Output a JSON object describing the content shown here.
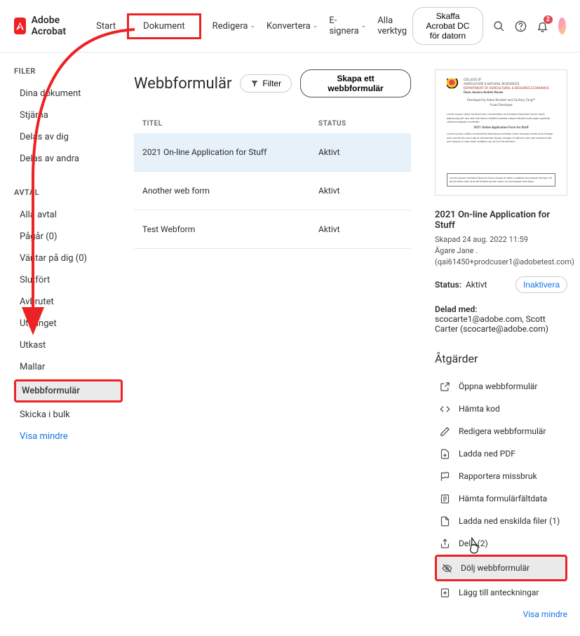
{
  "header": {
    "brand": "Adobe Acrobat",
    "nav": [
      "Start",
      "Dokument",
      "Redigera",
      "Konvertera",
      "E-signera",
      "Alla verktyg"
    ],
    "cta": "Skaffa Acrobat DC för datorn",
    "notification_count": "2"
  },
  "sidebar": {
    "section1_title": "FILER",
    "section1_items": [
      "Dina dokument",
      "Stjärna",
      "Delas av dig",
      "Delas av andra"
    ],
    "section2_title": "AVTAL",
    "section2_items": [
      "Alla avtal",
      "Pågår (0)",
      "Väntar på dig (0)",
      "Slutfört",
      "Avbrutet",
      "Utgånget",
      "Utkast",
      "Mallar",
      "Webbformulär",
      "Skicka i bulk"
    ],
    "show_less": "Visa mindre"
  },
  "content": {
    "title": "Webbformulär",
    "filter_label": "Filter",
    "create_label": "Skapa ett webbformulär",
    "th_title": "TITEL",
    "th_status": "STATUS",
    "rows": [
      {
        "title": "2021 On-line Application for Stuff",
        "status": "Aktivt"
      },
      {
        "title": "Another web form",
        "status": "Aktivt"
      },
      {
        "title": "Test Webform",
        "status": "Aktivt"
      }
    ]
  },
  "details": {
    "title": "2021 On-line Application for Stuff",
    "created": "Skapad 24 aug. 2022 11:59",
    "owner_label": "Ägare Jane .",
    "owner_email": "(qai61450+prodcuser1@adobetest.com)",
    "status_label": "Status:",
    "status_value": "Aktivt",
    "inactivate": "Inaktivera",
    "shared_label": "Delad med:",
    "shared_value": "scocarte1@adobe.com, Scott Carter (scocarte@adobe.com)",
    "actions_title": "Åtgärder",
    "actions": [
      "Öppna webbformulär",
      "Hämta kod",
      "Redigera webbformulär",
      "Ladda ned PDF",
      "Rapportera missbruk",
      "Hämta formulärfältdata",
      "Ladda ned enskilda filer (1)",
      "Dela (2)",
      "Dölj webbformulär",
      "Lägg till anteckningar"
    ],
    "show_less": "Visa mindre"
  }
}
